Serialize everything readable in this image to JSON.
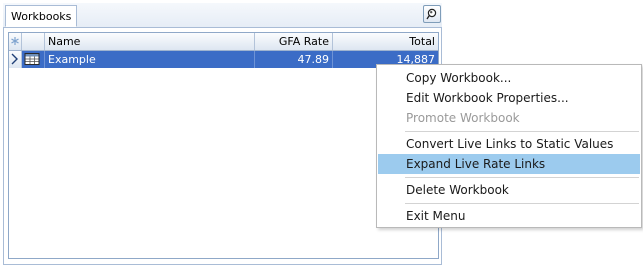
{
  "panel": {
    "tab_label": "Workbooks"
  },
  "grid": {
    "columns": [
      "Name",
      "GFA Rate",
      "Total"
    ],
    "rows": [
      {
        "name": "Example",
        "gfa_rate": "47.89",
        "total": "14,887",
        "selected": true
      }
    ]
  },
  "context_menu": {
    "items": [
      {
        "label": "Copy Workbook...",
        "enabled": true
      },
      {
        "label": "Edit Workbook Properties...",
        "enabled": true
      },
      {
        "label": "Promote Workbook",
        "enabled": false
      },
      {
        "label": "Convert Live Links to Static Values",
        "enabled": true
      },
      {
        "label": "Expand Live Rate Links",
        "enabled": true,
        "highlighted": true
      },
      {
        "label": "Delete Workbook",
        "enabled": true
      },
      {
        "label": "Exit Menu",
        "enabled": true
      }
    ]
  },
  "colors": {
    "selection": "#3b6cc6",
    "menu_highlight": "#9ccbee",
    "border": "#a9bcd6"
  },
  "icons": [
    "pin-icon",
    "header-asterisk-icon",
    "row-indicator-icon",
    "workbook-icon"
  ]
}
